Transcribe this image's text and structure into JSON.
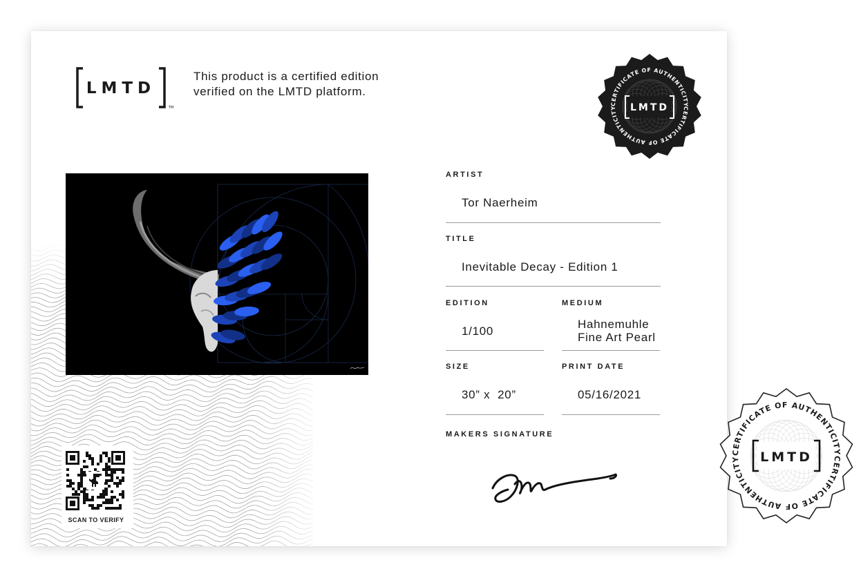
{
  "header": {
    "logo_text": "LMTD",
    "trademark": "TM",
    "tagline": [
      "This product is a certified edition",
      "verified on the LMTD platform."
    ]
  },
  "seal": {
    "ring_text": "CERTIFICATE OF AUTHENTICITY",
    "logo_text": "LMTD"
  },
  "fields": {
    "artist": {
      "label": "ARTIST",
      "value": "Tor Naerheim"
    },
    "title": {
      "label": "TITLE",
      "value": "Inevitable Decay - Edition 1"
    },
    "edition": {
      "label": "EDITION",
      "value": "1/100"
    },
    "medium": {
      "label": "MEDIUM",
      "value": [
        "Hahnemuhle",
        "Fine Art Pearl"
      ]
    },
    "size": {
      "label": "SIZE",
      "value": "30” x  20”"
    },
    "print_date": {
      "label": "PRINT DATE",
      "value": "05/16/2021"
    },
    "signature": {
      "label": "MAKERS SIGNATURE"
    }
  },
  "qr": {
    "caption": "SCAN TO VERIFY"
  },
  "colors": {
    "ink": "#1a1a1a",
    "seal_dark": "#1b1b1b",
    "feathers": "#1f4fd8",
    "rule": "#9a9a9a"
  },
  "icons": [
    "lmtd-logo-icon",
    "qr-code-icon",
    "dinosaur-icon",
    "certificate-seal-icon",
    "signature-icon"
  ]
}
